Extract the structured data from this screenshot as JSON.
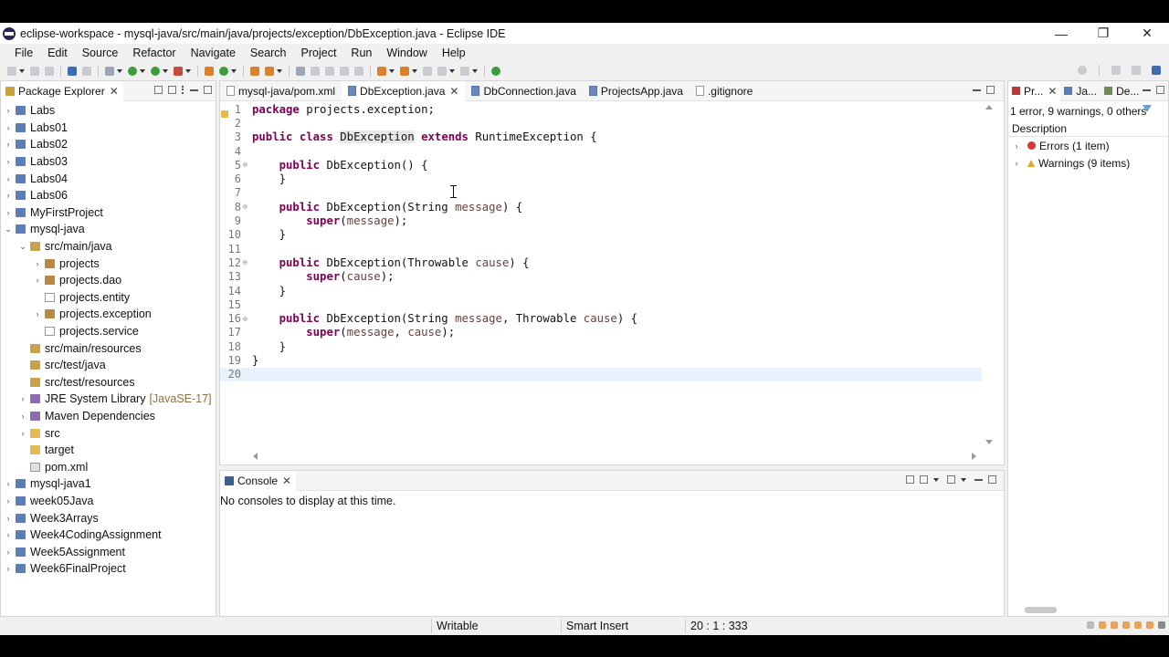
{
  "window": {
    "title": "eclipse-workspace - mysql-java/src/main/java/projects/exception/DbException.java - Eclipse IDE",
    "minimize_glyph": "—",
    "restore_glyph": "❐",
    "close_glyph": "✕"
  },
  "menu": [
    "File",
    "Edit",
    "Source",
    "Refactor",
    "Navigate",
    "Search",
    "Project",
    "Run",
    "Window",
    "Help"
  ],
  "package_explorer": {
    "tab_label": "Package Explorer",
    "items": [
      {
        "label": "Labs",
        "level": 0,
        "twisty": "closed",
        "icon": "project-icon"
      },
      {
        "label": "Labs01",
        "level": 0,
        "twisty": "closed",
        "icon": "project-icon"
      },
      {
        "label": "Labs02",
        "level": 0,
        "twisty": "closed",
        "icon": "project-icon"
      },
      {
        "label": "Labs03",
        "level": 0,
        "twisty": "closed",
        "icon": "project-icon"
      },
      {
        "label": "Labs04",
        "level": 0,
        "twisty": "closed",
        "icon": "project-icon"
      },
      {
        "label": "Labs06",
        "level": 0,
        "twisty": "closed",
        "icon": "project-icon"
      },
      {
        "label": "MyFirstProject",
        "level": 0,
        "twisty": "closed",
        "icon": "project-icon"
      },
      {
        "label": "mysql-java",
        "level": 0,
        "twisty": "open",
        "icon": "project-icon"
      },
      {
        "label": "src/main/java",
        "level": 1,
        "twisty": "open",
        "icon": "source-folder-icon"
      },
      {
        "label": "projects",
        "level": 2,
        "twisty": "closed",
        "icon": "package-icon"
      },
      {
        "label": "projects.dao",
        "level": 2,
        "twisty": "closed",
        "icon": "package-icon"
      },
      {
        "label": "projects.entity",
        "level": 2,
        "twisty": "none",
        "icon": "empty-package-icon"
      },
      {
        "label": "projects.exception",
        "level": 2,
        "twisty": "closed",
        "icon": "package-icon"
      },
      {
        "label": "projects.service",
        "level": 2,
        "twisty": "none",
        "icon": "empty-package-icon"
      },
      {
        "label": "src/main/resources",
        "level": 1,
        "twisty": "none",
        "icon": "source-folder-icon"
      },
      {
        "label": "src/test/java",
        "level": 1,
        "twisty": "none",
        "icon": "source-folder-icon"
      },
      {
        "label": "src/test/resources",
        "level": 1,
        "twisty": "none",
        "icon": "source-folder-icon"
      },
      {
        "label": "JRE System Library",
        "suffix": "[JavaSE-17]",
        "level": 1,
        "twisty": "closed",
        "icon": "library-icon"
      },
      {
        "label": "Maven Dependencies",
        "level": 1,
        "twisty": "closed",
        "icon": "library-icon"
      },
      {
        "label": "src",
        "level": 1,
        "twisty": "closed",
        "icon": "folder-icon"
      },
      {
        "label": "target",
        "level": 1,
        "twisty": "none",
        "icon": "folder-icon"
      },
      {
        "label": "pom.xml",
        "level": 1,
        "twisty": "none",
        "icon": "xml-file-icon"
      },
      {
        "label": "mysql-java1",
        "level": 0,
        "twisty": "closed",
        "icon": "project-icon"
      },
      {
        "label": "week05Java",
        "level": 0,
        "twisty": "closed",
        "icon": "project-icon"
      },
      {
        "label": "Week3Arrays",
        "level": 0,
        "twisty": "closed",
        "icon": "project-icon"
      },
      {
        "label": "Week4CodingAssignment",
        "level": 0,
        "twisty": "closed",
        "icon": "project-icon"
      },
      {
        "label": "Week5Assignment",
        "level": 0,
        "twisty": "closed",
        "icon": "project-icon"
      },
      {
        "label": "Week6FinalProject",
        "level": 0,
        "twisty": "closed",
        "icon": "project-icon"
      }
    ]
  },
  "editor": {
    "tabs": [
      {
        "label": "mysql-java/pom.xml",
        "active": false,
        "icon": "xml-file-icon"
      },
      {
        "label": "DbException.java",
        "active": true,
        "icon": "java-file-icon"
      },
      {
        "label": "DbConnection.java",
        "active": false,
        "icon": "java-file-icon"
      },
      {
        "label": "ProjectsApp.java",
        "active": false,
        "icon": "java-file-icon"
      },
      {
        "label": ".gitignore",
        "active": false,
        "icon": "text-file-icon"
      }
    ],
    "lines": [
      {
        "n": "1",
        "fold": "",
        "html": "<span class=\"kw\">package</span> projects.exception;"
      },
      {
        "n": "2",
        "fold": "",
        "html": ""
      },
      {
        "n": "3",
        "fold": "",
        "html": "<span class=\"kw\">public</span> <span class=\"kw\">class</span> <span class=\"type-hl\">DbException</span> <span class=\"kw\">extends</span> RuntimeException {"
      },
      {
        "n": "4",
        "fold": "",
        "html": ""
      },
      {
        "n": "5",
        "fold": "⊖",
        "html": "    <span class=\"kw\">public</span> DbException() {"
      },
      {
        "n": "6",
        "fold": "",
        "html": "    }"
      },
      {
        "n": "7",
        "fold": "",
        "html": ""
      },
      {
        "n": "8",
        "fold": "⊖",
        "html": "    <span class=\"kw\">public</span> DbException(String <span class=\"par\">message</span>) {"
      },
      {
        "n": "9",
        "fold": "",
        "html": "        <span class=\"kw\">super</span>(<span class=\"par\">message</span>);"
      },
      {
        "n": "10",
        "fold": "",
        "html": "    }"
      },
      {
        "n": "11",
        "fold": "",
        "html": ""
      },
      {
        "n": "12",
        "fold": "⊖",
        "html": "    <span class=\"kw\">public</span> DbException(Throwable <span class=\"par\">cause</span>) {"
      },
      {
        "n": "13",
        "fold": "",
        "html": "        <span class=\"kw\">super</span>(<span class=\"par\">cause</span>);"
      },
      {
        "n": "14",
        "fold": "",
        "html": "    }"
      },
      {
        "n": "15",
        "fold": "",
        "html": ""
      },
      {
        "n": "16",
        "fold": "⊖",
        "html": "    <span class=\"kw\">public</span> DbException(String <span class=\"par\">message</span>, Throwable <span class=\"par\">cause</span>) {"
      },
      {
        "n": "17",
        "fold": "",
        "html": "        <span class=\"kw\">super</span>(<span class=\"par\">message</span>, <span class=\"par\">cause</span>);"
      },
      {
        "n": "18",
        "fold": "",
        "html": "    }"
      },
      {
        "n": "19",
        "fold": "",
        "html": "}"
      },
      {
        "n": "20",
        "fold": "",
        "html": "",
        "current": true
      }
    ]
  },
  "console": {
    "tab_label": "Console",
    "message": "No consoles to display at this time."
  },
  "problems": {
    "tabs": [
      "Pr...",
      "Ja...",
      "De..."
    ],
    "summary": "1 error, 9 warnings, 0 others",
    "column": "Description",
    "rows": [
      {
        "label": "Errors (1 item)",
        "kind": "error"
      },
      {
        "label": "Warnings (9 items)",
        "kind": "warning"
      }
    ]
  },
  "statusbar": {
    "writable": "Writable",
    "insert_mode": "Smart Insert",
    "position": "20 : 1 : 333"
  },
  "colors": {
    "keyword": "#7f0055",
    "parameter": "#6a3e3e",
    "current_line": "#e8f2fe",
    "error": "#d03a3a",
    "warning": "#e0a92b"
  }
}
